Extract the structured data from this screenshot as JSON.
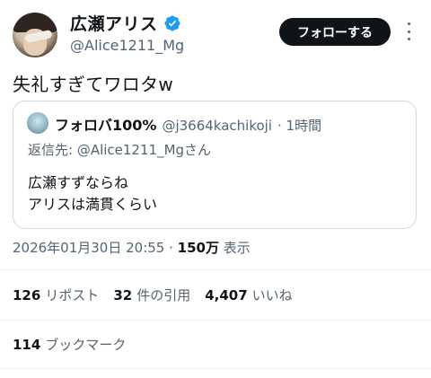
{
  "author": {
    "name": "広瀬アリス",
    "handle": "@Alice1211_Mg",
    "verified_icon": "verified-badge-icon"
  },
  "follow_button_label": "フォローする",
  "more_icon": "more-vertical-icon",
  "tweet_text": "失礼すぎてワロタw",
  "quote": {
    "name": "フォロバ100%",
    "handle": "@j3664kachikoji",
    "time": "· 1時間",
    "reply_to": "返信先: @Alice1211_Mgさん",
    "text_lines": [
      "広瀬すずならね",
      "アリスは満貫くらい"
    ]
  },
  "meta": {
    "timestamp": "2026年01月30日 20:55 ·",
    "views_count": "150万",
    "views_label": "表示"
  },
  "stats": [
    {
      "count": "126",
      "label": "リポスト"
    },
    {
      "count": "32",
      "label": "件の引用"
    },
    {
      "count": "4,407",
      "label": "いいね"
    }
  ],
  "bookmarks": {
    "count": "114",
    "label": "ブックマーク"
  },
  "colors": {
    "primary_text": "#0f1419",
    "secondary_text": "#536471",
    "verified_blue": "#1d9bf0",
    "border": "#cfd9de"
  }
}
